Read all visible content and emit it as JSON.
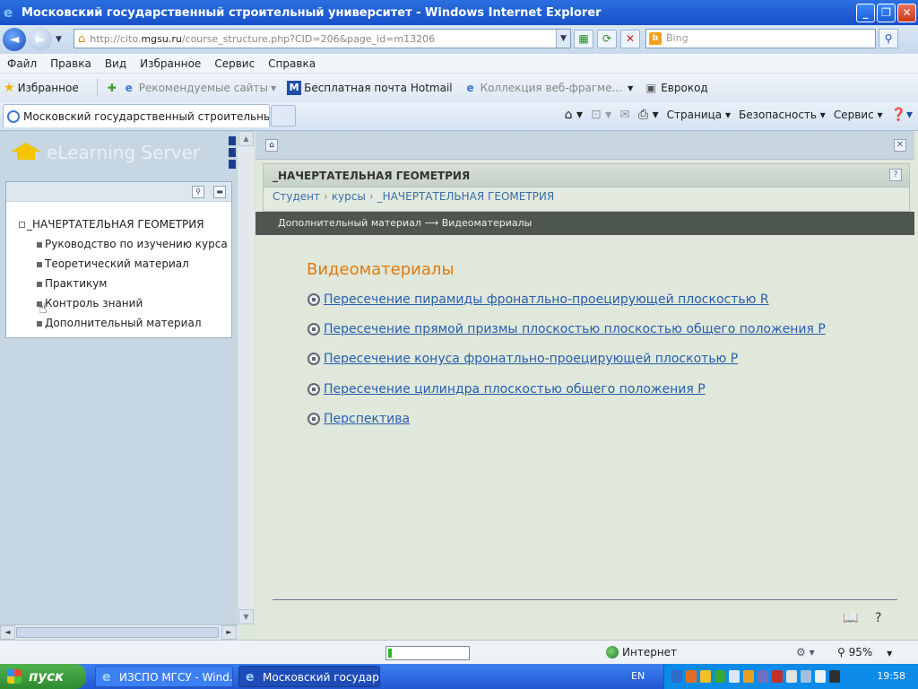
{
  "window": {
    "title": "Московский государственный строительный университет - Windows Internet Explorer",
    "minimize": "_",
    "maximize": "❐",
    "close": "✕"
  },
  "address": {
    "url_prefix": "http://cito.",
    "url_domain": "mgsu.ru",
    "url_path": "/course_structure.php?CID=206&page_id=m13206",
    "search_placeholder": "Bing"
  },
  "menu": [
    "Файл",
    "Правка",
    "Вид",
    "Избранное",
    "Сервис",
    "Справка"
  ],
  "favorites": {
    "label": "Избранное",
    "items": [
      {
        "label": "Рекомендуемые сайты",
        "dim": true
      },
      {
        "label": "Бесплатная почта Hotmail",
        "dim": false
      },
      {
        "label": "Коллекция веб-фрагме...",
        "dim": true
      },
      {
        "label": "Еврокод",
        "dim": false
      }
    ]
  },
  "tab": {
    "label": "Московский государственный строительный унив..."
  },
  "commands": [
    "Страница",
    "Безопасность",
    "Сервис"
  ],
  "left_panel": {
    "logo_text": "eLearning Server",
    "tree_root": "_НАЧЕРТАТЕЛЬНАЯ ГЕОМЕТРИЯ",
    "tree_items": [
      "Руководство по изучению курса",
      "Теоретический материал",
      "Практикум",
      "Контроль знаний",
      "Дополнительный материал"
    ]
  },
  "main": {
    "course_title": "_НАЧЕРТАТЕЛЬНАЯ ГЕОМЕТРИЯ",
    "breadcrumb": [
      "Студент",
      "курсы",
      "_НАЧЕРТАТЕЛЬНАЯ ГЕОМЕТРИЯ"
    ],
    "breadcrumb_sep": "›",
    "path_bar": "Дополнительный материал ⟶ Видеоматериалы",
    "heading": "Видеоматериалы",
    "links": [
      "Пересечение пирамиды фронатльно-проецирующей плоскостью R",
      "Пересечение прямой призмы плоскостью плоскостью общего положения P",
      "Пересечение конуса фронатльно-проецирующей плоскотью P",
      "Пересечение цилиндра плоскостью общего положения P",
      "Перспектива"
    ]
  },
  "status": {
    "zone": "Интернет",
    "zoom": "95%",
    "progress": 0.05
  },
  "taskbar": {
    "start": "пуск",
    "tasks": [
      {
        "label": "ИЗСПО МГСУ - Wind...",
        "active": false
      },
      {
        "label": "Московский государ...",
        "active": true
      }
    ],
    "lang": "EN",
    "clock": "19:58"
  },
  "colors": {
    "titlebar": "#1f5fd5",
    "heading": "#e07a10",
    "link": "#2a5db0",
    "path_bar": "#4e5650",
    "taskbar": "#2a63d8",
    "start": "#3a9a3a"
  }
}
